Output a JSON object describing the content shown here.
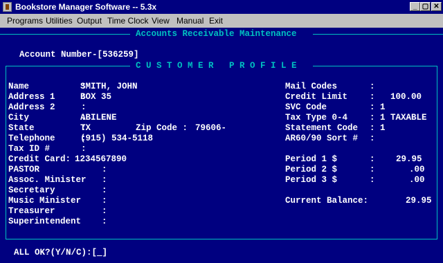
{
  "window": {
    "title": "Bookstore Manager Software -- 5.3x",
    "minimize": "_",
    "restore": "▢",
    "close": "✕"
  },
  "menu": [
    "Programs",
    "Utilities",
    "Output",
    "Time Clock",
    "View",
    "Manual",
    "Exit"
  ],
  "screen": {
    "header": "Accounts Receivable Maintenance",
    "account_label": "Account Number-[536259]",
    "section_title": "C U S T O M E R   P R O F I L E",
    "left_fields": [
      {
        "label": "Name          :",
        "value": "SMITH, JOHN"
      },
      {
        "label": "Address 1     :",
        "value": "BOX 35"
      },
      {
        "label": "Address 2     :",
        "value": ""
      },
      {
        "label": "City          :",
        "value": "ABILENE"
      },
      {
        "label": "State         :",
        "value": "TX"
      },
      {
        "label": "Telephone     :",
        "value": "(915) 534-5118"
      },
      {
        "label": "Tax ID #      :",
        "value": ""
      },
      {
        "label": "Credit Card:",
        "value": "1234567890"
      },
      {
        "label": "PASTOR            :",
        "value": ""
      },
      {
        "label": "Assoc. Minister   :",
        "value": ""
      },
      {
        "label": "Secretary         :",
        "value": ""
      },
      {
        "label": "Music Minister    :",
        "value": ""
      },
      {
        "label": "Treasurer         :",
        "value": ""
      },
      {
        "label": "Superintendent    :",
        "value": ""
      }
    ],
    "zip_label": "Zip Code :",
    "zip_value": "79606-",
    "right_fields": [
      {
        "label": "Mail Codes",
        "sep": ":",
        "value": ""
      },
      {
        "label": "Credit Limit",
        "sep": ":",
        "value": "100.00"
      },
      {
        "label": "SVC Code",
        "sep": ":",
        "value": "1"
      },
      {
        "label": "Tax Type 0-4",
        "sep": ":",
        "value": "1 TAXABLE"
      },
      {
        "label": "Statement Code",
        "sep": ":",
        "value": "1"
      },
      {
        "label": "AR60/90 Sort #",
        "sep": ":",
        "value": ""
      },
      {
        "label": "Period 1 $",
        "sep": ":",
        "value": "29.95"
      },
      {
        "label": "Period 2 $",
        "sep": ":",
        "value": ".00"
      },
      {
        "label": "Period 3 $",
        "sep": ":",
        "value": ".00"
      },
      {
        "label": "Current Balance:",
        "sep": "",
        "value": "29.95"
      }
    ],
    "prompt": "ALL OK?(Y/N/C):[",
    "prompt_cursor": "_",
    "prompt_end": "]"
  }
}
